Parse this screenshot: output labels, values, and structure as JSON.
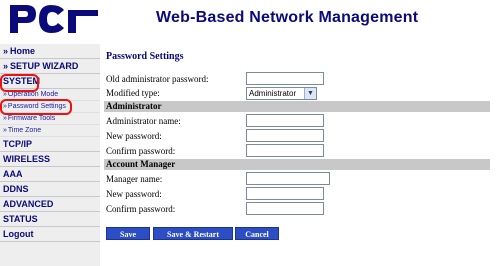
{
  "app": {
    "logo_text": "PCi",
    "title": "Web-Based Network Management"
  },
  "sidebar": {
    "items": [
      {
        "prefix": "»",
        "label": "Home"
      },
      {
        "prefix": "»",
        "label": "SETUP WIZARD"
      },
      {
        "prefix": "",
        "label": "SYSTEM"
      },
      {
        "prefix": "»",
        "label": "Operation Mode"
      },
      {
        "prefix": "»",
        "label": "Password Settings"
      },
      {
        "prefix": "»",
        "label": "Firmware Tools"
      },
      {
        "prefix": "»",
        "label": "Time Zone"
      },
      {
        "prefix": "",
        "label": "TCP/IP"
      },
      {
        "prefix": "",
        "label": "WIRELESS"
      },
      {
        "prefix": "",
        "label": "AAA"
      },
      {
        "prefix": "",
        "label": "DDNS"
      },
      {
        "prefix": "",
        "label": "ADVANCED"
      },
      {
        "prefix": "",
        "label": "STATUS"
      },
      {
        "prefix": "",
        "label": "Logout"
      }
    ]
  },
  "form": {
    "title": "Password Settings",
    "old_admin_password_label": "Old administrator password:",
    "old_admin_password_value": "",
    "modified_type_label": "Modified type:",
    "modified_type_value": "Administrator",
    "admin_section": "Administrator",
    "admin_name_label": "Administrator name:",
    "admin_name_value": "",
    "admin_new_password_label": "New password:",
    "admin_confirm_password_label": "Confirm password:",
    "manager_section": "Account Manager",
    "manager_name_label": "Manager name:",
    "manager_name_value": "",
    "manager_new_password_label": "New password:",
    "manager_confirm_password_label": "Confirm password:"
  },
  "buttons": {
    "save": "Save",
    "save_restart": "Save & Restart",
    "cancel": "Cancel"
  },
  "colors": {
    "title_blue": "#0a0a7a",
    "button_blue": "#2c4ec4",
    "highlight_red": "#ee1111",
    "section_gray": "#c8c8c8"
  }
}
